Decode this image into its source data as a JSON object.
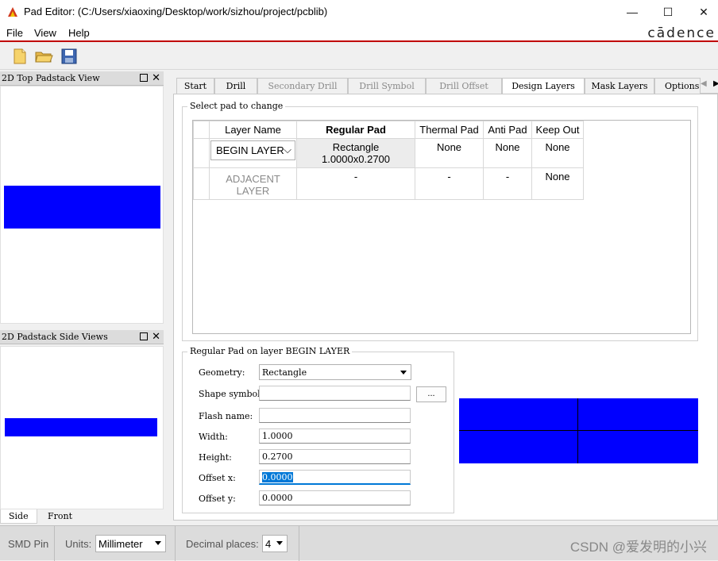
{
  "window": {
    "title": "Pad Editor:   (C:/Users/xiaoxing/Desktop/work/sizhou/project/pcblib)",
    "minimize": "—",
    "maximize": "☐",
    "close": "✕"
  },
  "menu": {
    "file": "File",
    "view": "View",
    "help": "Help",
    "brand": "cādence"
  },
  "toolbar": {
    "icons": [
      "new-file-icon",
      "open-folder-icon",
      "save-icon"
    ]
  },
  "top_view": {
    "title": "2D Top Padstack View",
    "float": "",
    "close": "✕"
  },
  "side_view": {
    "title": "2D Padstack Side Views",
    "close": "✕",
    "tabs": [
      "Side",
      "Front"
    ]
  },
  "tabs": [
    "Start",
    "Drill",
    "Secondary Drill",
    "Drill Symbol",
    "Drill Offset",
    "Design Layers",
    "Mask Layers",
    "Options"
  ],
  "select_pad": {
    "legend": "Select pad to change",
    "headers": [
      "Layer Name",
      "Regular Pad",
      "Thermal Pad",
      "Anti Pad",
      "Keep Out"
    ],
    "rows": [
      {
        "layer": "BEGIN LAYER",
        "regular": "Rectangle 1.0000x0.2700",
        "thermal": "None",
        "anti": "None",
        "keepout": "None"
      },
      {
        "layer": "ADJACENT LAYER",
        "regular": "-",
        "thermal": "-",
        "anti": "-",
        "keepout": "None"
      }
    ]
  },
  "regular_pad": {
    "legend": "Regular Pad on layer BEGIN LAYER",
    "geometry_label": "Geometry:",
    "geometry_value": "Rectangle",
    "shape_label": "Shape symbol:",
    "shape_value": "",
    "browse": "...",
    "flash_label": "Flash name:",
    "flash_value": "",
    "width_label": "Width:",
    "width_value": "1.0000",
    "height_label": "Height:",
    "height_value": "0.2700",
    "offx_label": "Offset x:",
    "offx_value": "0.0000",
    "offy_label": "Offset y:",
    "offy_value": "0.0000"
  },
  "status": {
    "mode": "SMD Pin",
    "units_label": "Units:",
    "units_value": "Millimeter",
    "decimal_label": "Decimal places:",
    "decimal_value": "4",
    "watermark": "CSDN @爱发明的小兴"
  },
  "colors": {
    "pad": "#0000ff",
    "accent": "#c00000"
  }
}
